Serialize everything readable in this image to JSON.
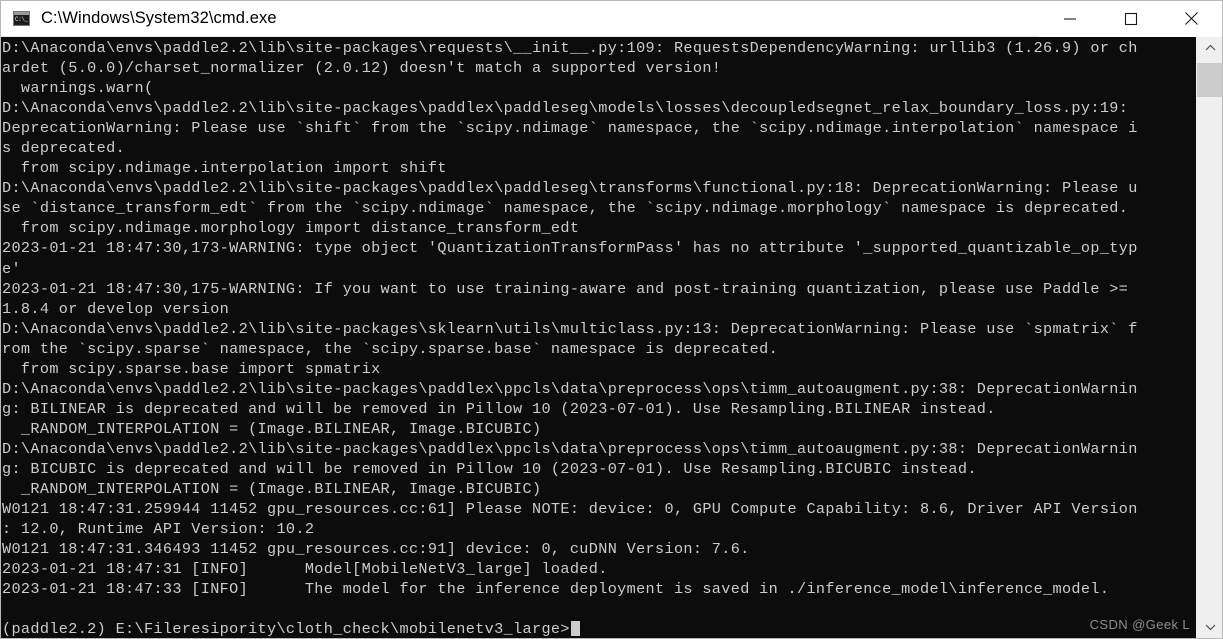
{
  "window": {
    "title": "C:\\Windows\\System32\\cmd.exe",
    "icon_name": "cmd-icon",
    "icon_glyph": "C:\\_",
    "controls": {
      "minimize_label": "Minimize",
      "maximize_label": "Maximize",
      "close_label": "Close"
    }
  },
  "console": {
    "background_color": "#0c0c0c",
    "foreground_color": "#cccccc",
    "lines": [
      "D:\\Anaconda\\envs\\paddle2.2\\lib\\site-packages\\requests\\__init__.py:109: RequestsDependencyWarning: urllib3 (1.26.9) or ch",
      "ardet (5.0.0)/charset_normalizer (2.0.12) doesn't match a supported version!",
      "  warnings.warn(",
      "D:\\Anaconda\\envs\\paddle2.2\\lib\\site-packages\\paddlex\\paddleseg\\models\\losses\\decoupledsegnet_relax_boundary_loss.py:19:",
      "DeprecationWarning: Please use `shift` from the `scipy.ndimage` namespace, the `scipy.ndimage.interpolation` namespace i",
      "s deprecated.",
      "  from scipy.ndimage.interpolation import shift",
      "D:\\Anaconda\\envs\\paddle2.2\\lib\\site-packages\\paddlex\\paddleseg\\transforms\\functional.py:18: DeprecationWarning: Please u",
      "se `distance_transform_edt` from the `scipy.ndimage` namespace, the `scipy.ndimage.morphology` namespace is deprecated.",
      "  from scipy.ndimage.morphology import distance_transform_edt",
      "2023-01-21 18:47:30,173-WARNING: type object 'QuantizationTransformPass' has no attribute '_supported_quantizable_op_typ",
      "e'",
      "2023-01-21 18:47:30,175-WARNING: If you want to use training-aware and post-training quantization, please use Paddle >=",
      "1.8.4 or develop version",
      "D:\\Anaconda\\envs\\paddle2.2\\lib\\site-packages\\sklearn\\utils\\multiclass.py:13: DeprecationWarning: Please use `spmatrix` f",
      "rom the `scipy.sparse` namespace, the `scipy.sparse.base` namespace is deprecated.",
      "  from scipy.sparse.base import spmatrix",
      "D:\\Anaconda\\envs\\paddle2.2\\lib\\site-packages\\paddlex\\ppcls\\data\\preprocess\\ops\\timm_autoaugment.py:38: DeprecationWarnin",
      "g: BILINEAR is deprecated and will be removed in Pillow 10 (2023-07-01). Use Resampling.BILINEAR instead.",
      "  _RANDOM_INTERPOLATION = (Image.BILINEAR, Image.BICUBIC)",
      "D:\\Anaconda\\envs\\paddle2.2\\lib\\site-packages\\paddlex\\ppcls\\data\\preprocess\\ops\\timm_autoaugment.py:38: DeprecationWarnin",
      "g: BICUBIC is deprecated and will be removed in Pillow 10 (2023-07-01). Use Resampling.BICUBIC instead.",
      "  _RANDOM_INTERPOLATION = (Image.BILINEAR, Image.BICUBIC)",
      "W0121 18:47:31.259944 11452 gpu_resources.cc:61] Please NOTE: device: 0, GPU Compute Capability: 8.6, Driver API Version",
      ": 12.0, Runtime API Version: 10.2",
      "W0121 18:47:31.346493 11452 gpu_resources.cc:91] device: 0, cuDNN Version: 7.6.",
      "2023-01-21 18:47:31 [INFO]\tModel[MobileNetV3_large] loaded.",
      "2023-01-21 18:47:33 [INFO]\tThe model for the inference deployment is saved in ./inference_model\\inference_model.",
      ""
    ],
    "prompt": "(paddle2.2) E:\\Fileresipority\\cloth_check\\mobilenetv3_large>"
  },
  "scrollbar": {
    "up_arrow_name": "scroll-up-arrow",
    "down_arrow_name": "scroll-down-arrow",
    "thumb_name": "scroll-thumb"
  },
  "watermark": {
    "text": "CSDN @Geek L"
  }
}
